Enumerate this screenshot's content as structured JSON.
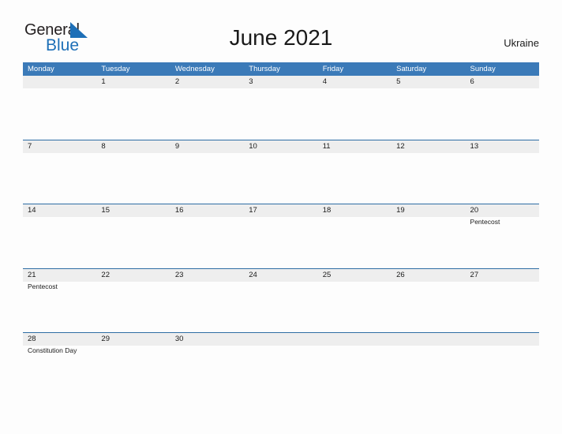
{
  "brand": {
    "name_part1": "General",
    "name_part2": "Blue",
    "triangle_icon": "triangle-icon",
    "color_primary": "#1d6fb7",
    "color_text": "#231f20"
  },
  "header": {
    "title": "June 2021",
    "country": "Ukraine"
  },
  "colors": {
    "weekday_header_bg": "#3b7ab8",
    "weekday_header_text": "#ffffff",
    "date_band_bg": "#eeeeee",
    "week_separator": "#2e6da4",
    "page_bg": "#fdfdfd",
    "text": "#1a1a1a"
  },
  "calendar": {
    "month": "June",
    "year": "2021",
    "weekdays": [
      "Monday",
      "Tuesday",
      "Wednesday",
      "Thursday",
      "Friday",
      "Saturday",
      "Sunday"
    ],
    "weeks": [
      {
        "days": [
          {
            "num": "",
            "events": []
          },
          {
            "num": "1",
            "events": []
          },
          {
            "num": "2",
            "events": []
          },
          {
            "num": "3",
            "events": []
          },
          {
            "num": "4",
            "events": []
          },
          {
            "num": "5",
            "events": []
          },
          {
            "num": "6",
            "events": []
          }
        ]
      },
      {
        "days": [
          {
            "num": "7",
            "events": []
          },
          {
            "num": "8",
            "events": []
          },
          {
            "num": "9",
            "events": []
          },
          {
            "num": "10",
            "events": []
          },
          {
            "num": "11",
            "events": []
          },
          {
            "num": "12",
            "events": []
          },
          {
            "num": "13",
            "events": []
          }
        ]
      },
      {
        "days": [
          {
            "num": "14",
            "events": []
          },
          {
            "num": "15",
            "events": []
          },
          {
            "num": "16",
            "events": []
          },
          {
            "num": "17",
            "events": []
          },
          {
            "num": "18",
            "events": []
          },
          {
            "num": "19",
            "events": []
          },
          {
            "num": "20",
            "events": [
              "Pentecost"
            ]
          }
        ]
      },
      {
        "days": [
          {
            "num": "21",
            "events": [
              "Pentecost"
            ]
          },
          {
            "num": "22",
            "events": []
          },
          {
            "num": "23",
            "events": []
          },
          {
            "num": "24",
            "events": []
          },
          {
            "num": "25",
            "events": []
          },
          {
            "num": "26",
            "events": []
          },
          {
            "num": "27",
            "events": []
          }
        ]
      },
      {
        "days": [
          {
            "num": "28",
            "events": [
              "Constitution Day"
            ]
          },
          {
            "num": "29",
            "events": []
          },
          {
            "num": "30",
            "events": []
          },
          {
            "num": "",
            "events": []
          },
          {
            "num": "",
            "events": []
          },
          {
            "num": "",
            "events": []
          },
          {
            "num": "",
            "events": []
          }
        ]
      }
    ]
  }
}
